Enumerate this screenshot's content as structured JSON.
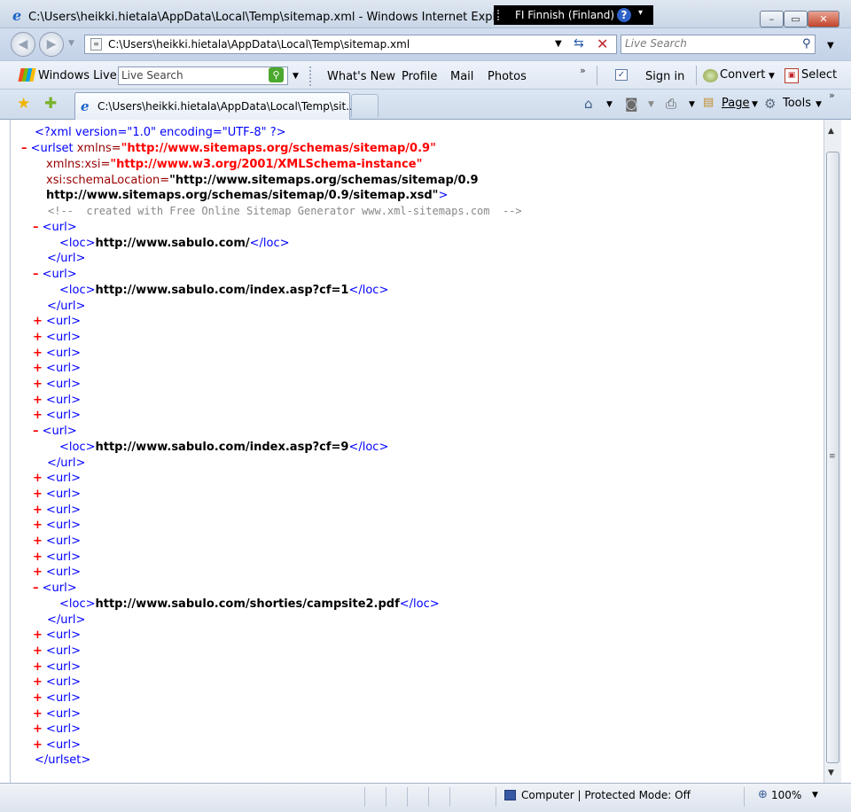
{
  "window": {
    "title": "C:\\Users\\heikki.hietala\\AppData\\Local\\Temp\\sitemap.xml - Windows Internet Explorer",
    "language_bar": "FI Finnish (Finland)",
    "help_glyph": "?",
    "minimize": "–",
    "maximize": "▭",
    "close": "✕"
  },
  "address_bar": {
    "url": "C:\\Users\\heikki.hietala\\AppData\\Local\\Temp\\sitemap.xml",
    "search_placeholder": "Live Search"
  },
  "links_toolbar": {
    "windows_live": "Windows Live",
    "live_search_placeholder": "Live Search",
    "whats_new": "What's New",
    "profile": "Profile",
    "mail": "Mail",
    "photos": "Photos",
    "more": "»",
    "sign_in": "Sign in",
    "convert": "Convert",
    "select": "Select"
  },
  "tab_bar": {
    "tab_title": "C:\\Users\\heikki.hietala\\AppData\\Local\\Temp\\sit...",
    "page_menu": "Page",
    "tools_menu": "Tools",
    "more": "»"
  },
  "xml": {
    "decl": "<?xml version=\"1.0\" encoding=\"UTF-8\" ?>",
    "urlset_open": "<urlset",
    "xmlns_attr": " xmlns=",
    "xmlns_val": "\"http://www.sitemaps.org/schemas/sitemap/0.9\"",
    "xsi_attr": "xmlns:xsi=",
    "xsi_val": "\"http://www.w3.org/2001/XMLSchema-instance\"",
    "schema_attr": "xsi:schemaLocation=",
    "schema_val_1": "\"http://www.sitemaps.org/schemas/sitemap/0.9",
    "schema_val_2": "http://www.sitemaps.org/schemas/sitemap/0.9/sitemap.xsd\"",
    "schema_close": ">",
    "comment": "<!--  created with Free Online Sitemap Generator www.xml-sitemaps.com  -->",
    "url_open": "<url>",
    "url_close": "</url>",
    "loc_open": "<loc>",
    "loc_close": "</loc>",
    "urlset_close": "</urlset>",
    "expand": "+",
    "collapse": "–",
    "locs": [
      "http://www.sabulo.com/",
      "http://www.sabulo.com/index.asp?cf=1",
      "http://www.sabulo.com/index.asp?cf=9",
      "http://www.sabulo.com/shorties/campsite2.pdf"
    ]
  },
  "status_bar": {
    "zone": "Computer | Protected Mode: Off",
    "zoom": "100%"
  }
}
